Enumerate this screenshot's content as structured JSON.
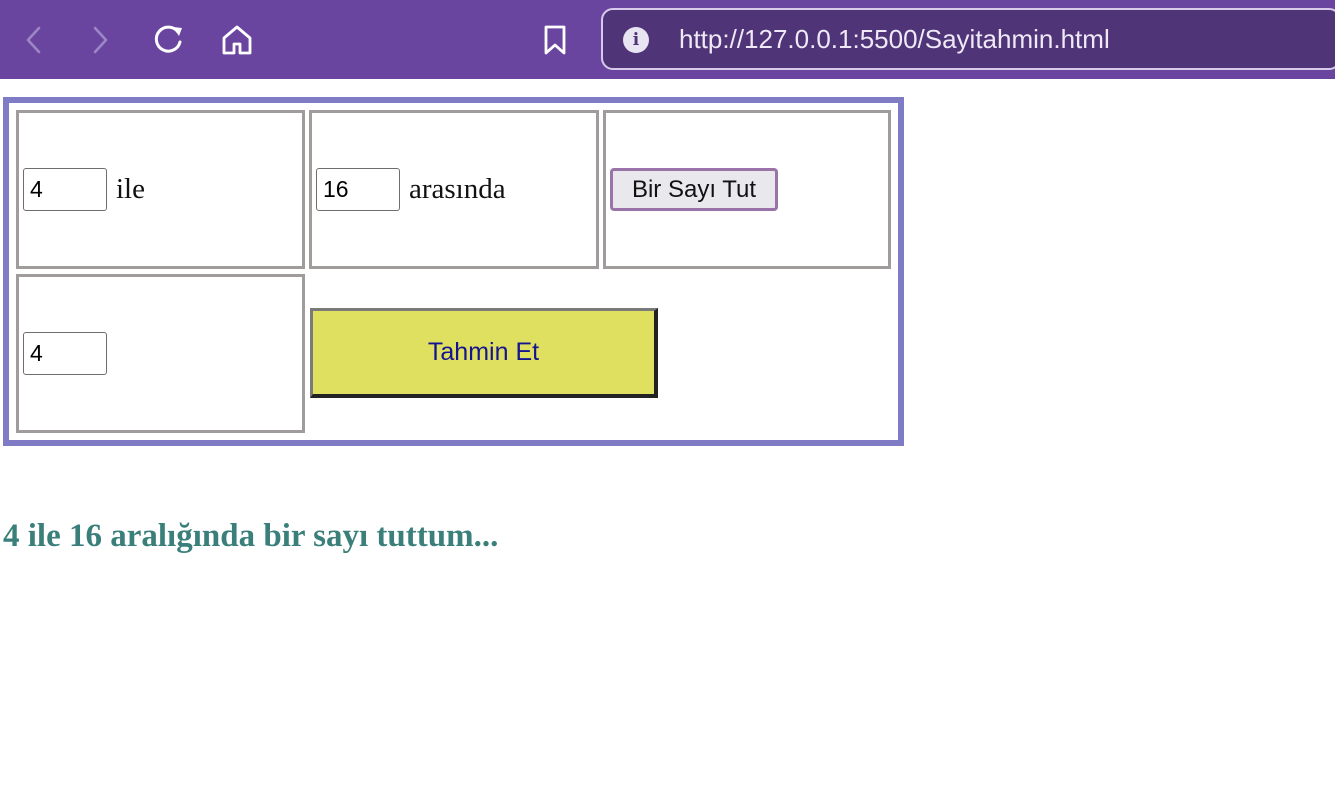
{
  "browser": {
    "url": "http://127.0.0.1:5500/Sayitahmin.html",
    "icons": [
      "back-arrow-icon",
      "forward-arrow-icon",
      "reload-icon",
      "home-icon",
      "bookmark-icon",
      "info-icon"
    ],
    "colors": {
      "toolbar": "#6a45a0",
      "urlbar": "#4f3478"
    }
  },
  "game": {
    "min_value": "4",
    "min_label": "ile",
    "max_value": "16",
    "max_label": "arasında",
    "pick_button_label": "Bir Sayı Tut",
    "guess_value": "4",
    "guess_button_label": "Tahmin Et",
    "message": "4 ile 16 aralığında bir sayı tuttum...",
    "colors": {
      "table_border": "#7f7bc4",
      "guess_button_bg": "#dfdf60",
      "message_text": "#3a7f7a"
    }
  }
}
